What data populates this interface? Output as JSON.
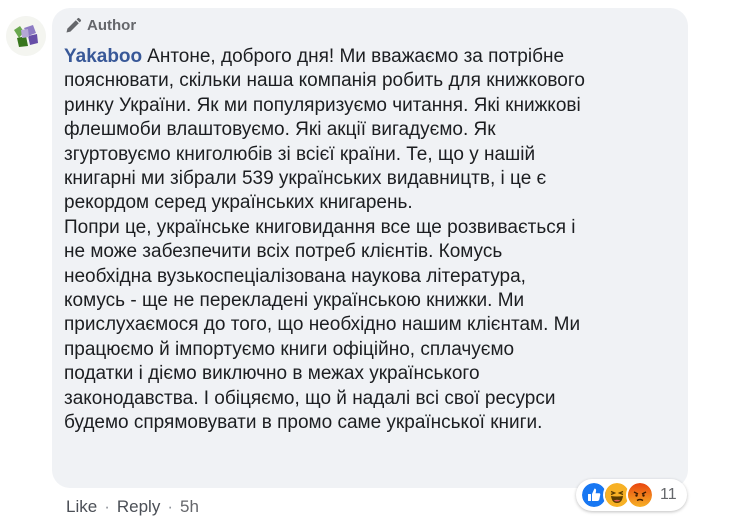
{
  "comment": {
    "badge_label": "Author",
    "author_name": "Yakaboo",
    "text": "Антоне, доброго дня! Ми вважаємо за потрібне\nпояснювати, скільки наша компанія робить для книжкового\nринку України. Як ми популяризуємо читання. Які книжкові\nфлешмоби влаштовуємо. Які акції вигадуємо. Як\nзгуртовуємо книголюбів зі всієї країни. Те, що у нашій\nкнигарні ми зібрали 539 українських видавництв, і це є\nрекордом серед українських книгарень.\nПопри це, українське книговидання все ще розвивається і\nне може забезпечити всіх потреб клієнтів. Комусь\nнеобхідна вузькоспеціалізована наукова література,\nкомусь - ще не перекладені українською книжки. Ми\nприслухаємося до того, що необхідно нашим клієнтам. Ми\nпрацюємо й імпортуємо книги офіційно, сплачуємо\nподатки і діємо виключно в межах українського\nзаконодавства. І обіцяємо, що й надалі всі свої ресурси\nбудемо спрямовувати в промо саме української книги."
  },
  "actions": {
    "like_label": "Like",
    "separator": "·",
    "reply_label": "Reply",
    "time": "5h"
  },
  "reactions": {
    "icons": [
      "like-reaction-icon",
      "haha-reaction-icon",
      "angry-reaction-icon"
    ],
    "count": "11"
  },
  "colors": {
    "bubble_bg": "#f0f2f5",
    "author_name": "#385898",
    "meta_text": "#65676b",
    "like_blue": "#1877f2",
    "haha_yellow": "#f7b125",
    "angry_orange": "#e9710f"
  }
}
